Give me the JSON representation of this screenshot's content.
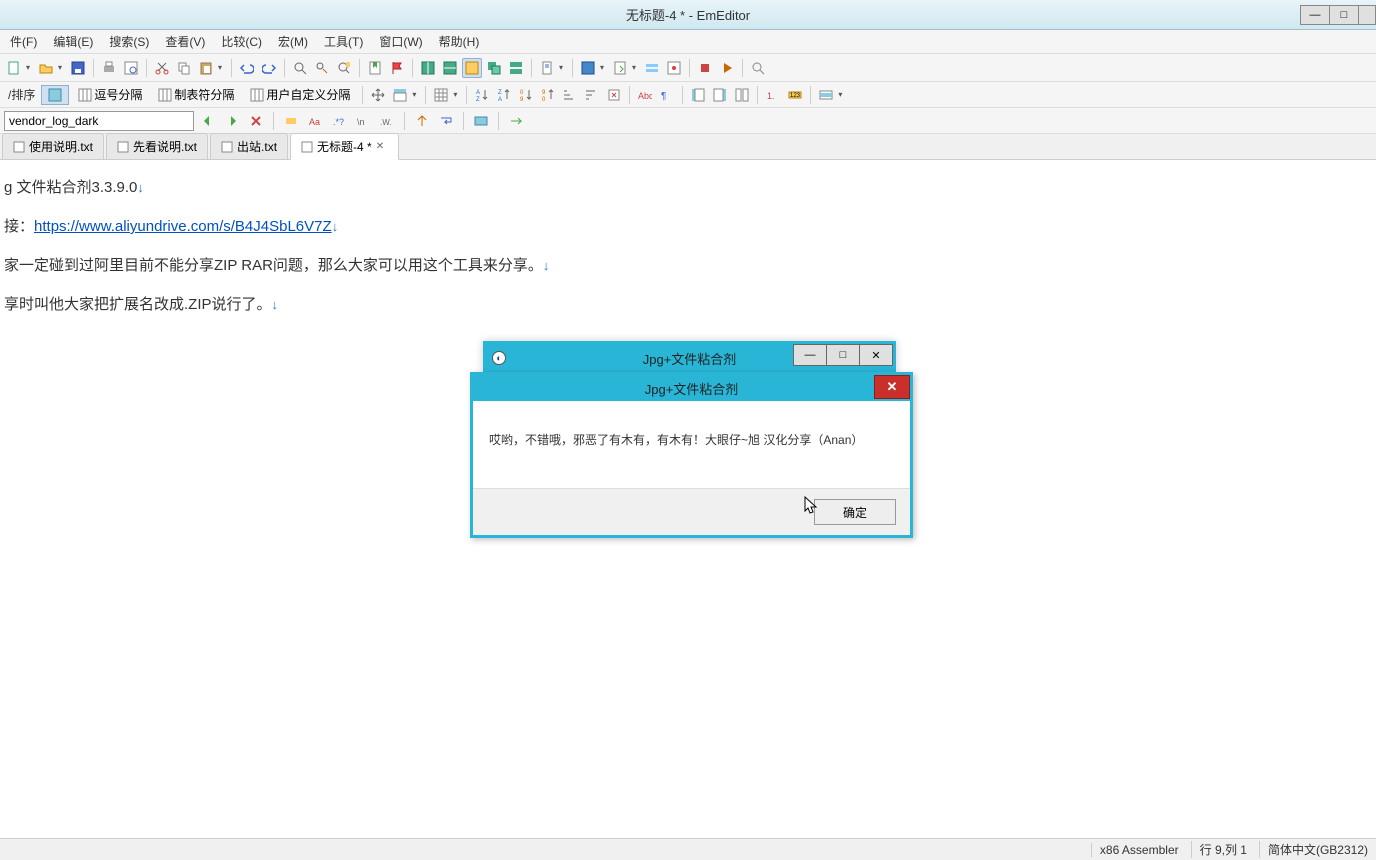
{
  "window": {
    "title": "无标题-4 * - EmEditor"
  },
  "menus": [
    "件(F)",
    "编辑(E)",
    "搜索(S)",
    "查看(V)",
    "比较(C)",
    "宏(M)",
    "工具(T)",
    "窗口(W)",
    "帮助(H)"
  ],
  "toolbar2": {
    "sort_label": "/排序",
    "comma_label": "逗号分隔",
    "tab_label": "制表符分隔",
    "user_label": "用户自定义分隔"
  },
  "combo_value": "vendor_log_dark",
  "tabs": [
    {
      "label": "使用说明.txt",
      "active": false
    },
    {
      "label": "先看说明.txt",
      "active": false
    },
    {
      "label": "出站.txt",
      "active": false
    },
    {
      "label": "无标题-4 *",
      "active": true
    }
  ],
  "editor": {
    "line1_prefix": "g 文件粘合剂3.3.9.0",
    "line2_prefix": "接：",
    "line2_link": "https://www.aliyundrive.com/s/B4J4SbL6V7Z",
    "line3": "家一定碰到过阿里目前不能分享ZIP RAR问题，那么大家可以用这个工具来分享。",
    "line4": "享时叫他大家把扩展名改成.ZIP说行了。"
  },
  "dialog_back": {
    "title": "Jpg+文件粘合剂"
  },
  "dialog_front": {
    "title": "Jpg+文件粘合剂",
    "message": "哎哟，不错哦，邪恶了有木有，有木有！大眼仔~旭 汉化分享（Anan）",
    "ok": "确定"
  },
  "status": {
    "mode": "x86 Assembler",
    "pos": "行 9,列 1",
    "enc": "简体中文(GB2312)"
  }
}
